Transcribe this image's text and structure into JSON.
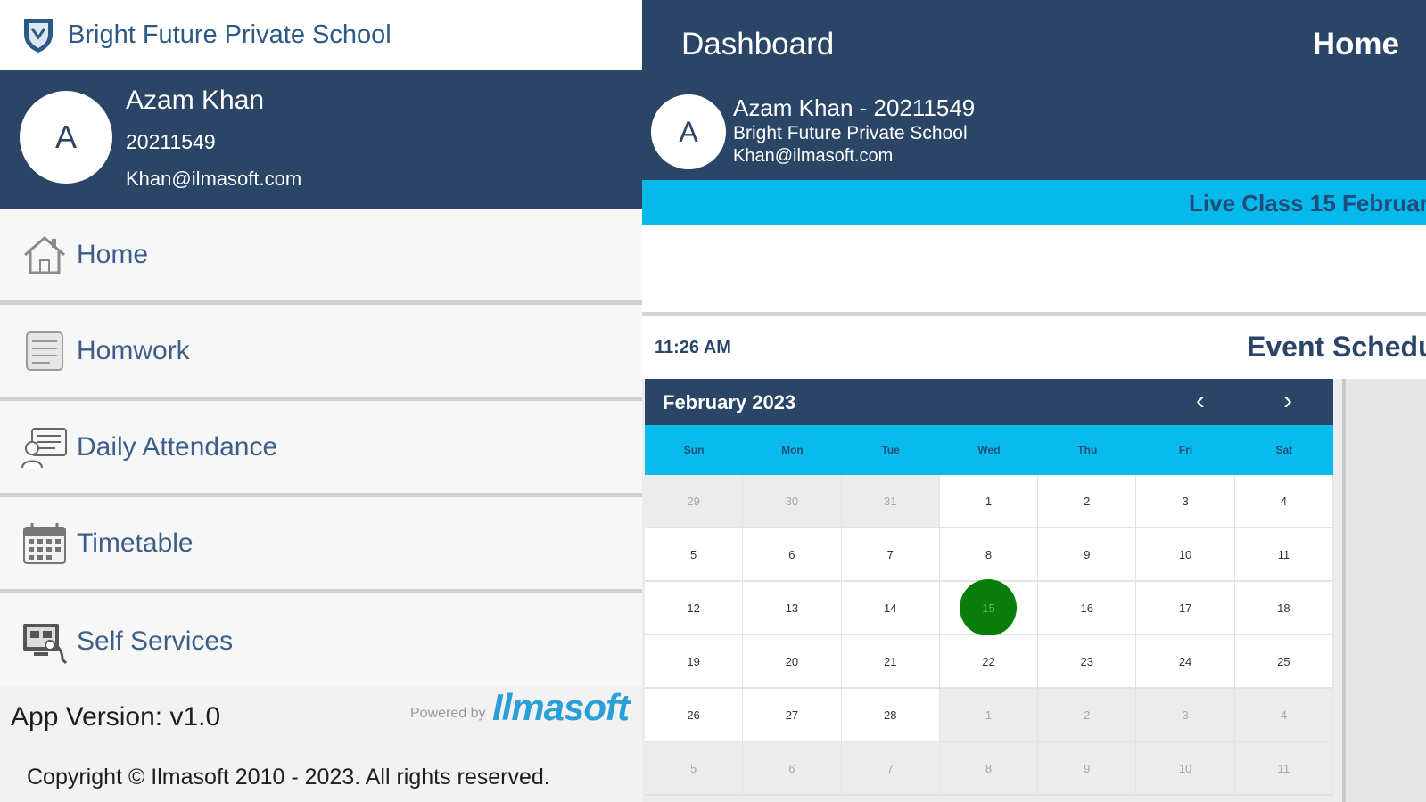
{
  "drawer": {
    "school_name": "Bright Future Private School",
    "profile": {
      "avatar_letter": "A",
      "name": "Azam Khan",
      "id": "20211549",
      "email": "Khan@ilmasoft.com"
    },
    "menu": [
      {
        "label": "Home",
        "icon": "home-icon"
      },
      {
        "label": "Homwork",
        "icon": "homework-icon"
      },
      {
        "label": "Daily Attendance",
        "icon": "attendance-icon"
      },
      {
        "label": "Timetable",
        "icon": "calendar-icon"
      },
      {
        "label": "Self Services",
        "icon": "self-services-icon"
      }
    ],
    "footer": {
      "app_version": "App Version: v1.0",
      "powered_by": "Powered by",
      "brand": "Ilmasoft",
      "copyright": "Copyright © Ilmasoft 2010 - 2023. All rights reserved."
    }
  },
  "dashboard": {
    "title": "Dashboard",
    "home_label": "Home",
    "user": {
      "avatar_letter": "A",
      "line1": "Azam Khan - 20211549",
      "line2": "Bright Future Private School",
      "line3": "Khan@ilmasoft.com"
    },
    "ticker": "Live Class 15 Februar",
    "time": "11:26 AM",
    "event_title": "Event Schedu",
    "calendar": {
      "month_label": "February 2023",
      "weekdays": [
        "Sun",
        "Mon",
        "Tue",
        "Wed",
        "Thu",
        "Fri",
        "Sat"
      ],
      "weeks": [
        [
          {
            "d": "29",
            "o": true
          },
          {
            "d": "30",
            "o": true
          },
          {
            "d": "31",
            "o": true
          },
          {
            "d": "1"
          },
          {
            "d": "2"
          },
          {
            "d": "3"
          },
          {
            "d": "4"
          }
        ],
        [
          {
            "d": "5"
          },
          {
            "d": "6"
          },
          {
            "d": "7"
          },
          {
            "d": "8"
          },
          {
            "d": "9"
          },
          {
            "d": "10"
          },
          {
            "d": "11"
          }
        ],
        [
          {
            "d": "12"
          },
          {
            "d": "13"
          },
          {
            "d": "14"
          },
          {
            "d": "15",
            "today": true
          },
          {
            "d": "16"
          },
          {
            "d": "17"
          },
          {
            "d": "18"
          }
        ],
        [
          {
            "d": "19"
          },
          {
            "d": "20"
          },
          {
            "d": "21"
          },
          {
            "d": "22"
          },
          {
            "d": "23"
          },
          {
            "d": "24"
          },
          {
            "d": "25"
          }
        ],
        [
          {
            "d": "26"
          },
          {
            "d": "27"
          },
          {
            "d": "28"
          },
          {
            "d": "1",
            "o": true
          },
          {
            "d": "2",
            "o": true
          },
          {
            "d": "3",
            "o": true
          },
          {
            "d": "4",
            "o": true
          }
        ],
        [
          {
            "d": "5",
            "o": true
          },
          {
            "d": "6",
            "o": true
          },
          {
            "d": "7",
            "o": true
          },
          {
            "d": "8",
            "o": true
          },
          {
            "d": "9",
            "o": true
          },
          {
            "d": "10",
            "o": true
          },
          {
            "d": "11",
            "o": true
          }
        ]
      ]
    }
  },
  "colors": {
    "navy": "#2b4567",
    "cyan": "#06b9ea",
    "today": "#0a7d0a",
    "menu_text": "#3c5f88"
  }
}
